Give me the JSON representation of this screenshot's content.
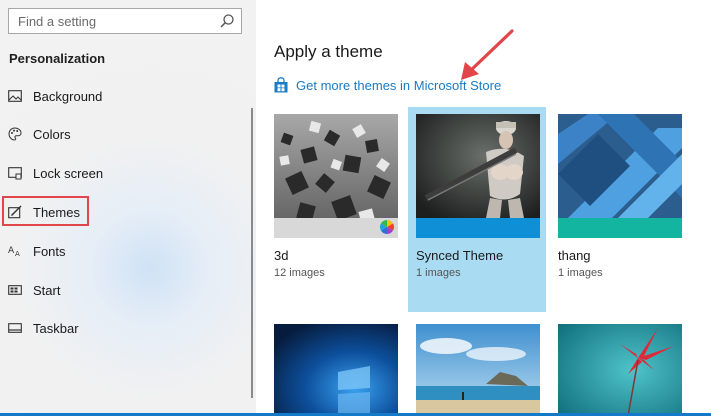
{
  "sidebar": {
    "search": {
      "placeholder": "Find a setting"
    },
    "section_title": "Personalization",
    "items": [
      {
        "label": "Background",
        "icon": "background-icon"
      },
      {
        "label": "Colors",
        "icon": "palette-icon"
      },
      {
        "label": "Lock screen",
        "icon": "lock-screen-icon"
      },
      {
        "label": "Themes",
        "icon": "themes-icon"
      },
      {
        "label": "Fonts",
        "icon": "fonts-icon"
      },
      {
        "label": "Start",
        "icon": "start-icon"
      },
      {
        "label": "Taskbar",
        "icon": "taskbar-icon"
      }
    ],
    "highlighted_item": "Themes",
    "highlight_color": "#e0464a"
  },
  "main": {
    "title": "Apply a theme",
    "store_link": {
      "label": "Get more themes in Microsoft Store",
      "icon": "store-bag-icon",
      "color": "#1a7bc4"
    },
    "annotation_arrow_color": "#e0464a",
    "themes": [
      {
        "name": "3d",
        "count": "12 images",
        "selected": false
      },
      {
        "name": "Synced Theme",
        "count": "1 images",
        "selected": true
      },
      {
        "name": "thang",
        "count": "1 images",
        "selected": false
      }
    ],
    "selection_color": "#a9dbf3",
    "accent_color": "#0f8fd6"
  }
}
